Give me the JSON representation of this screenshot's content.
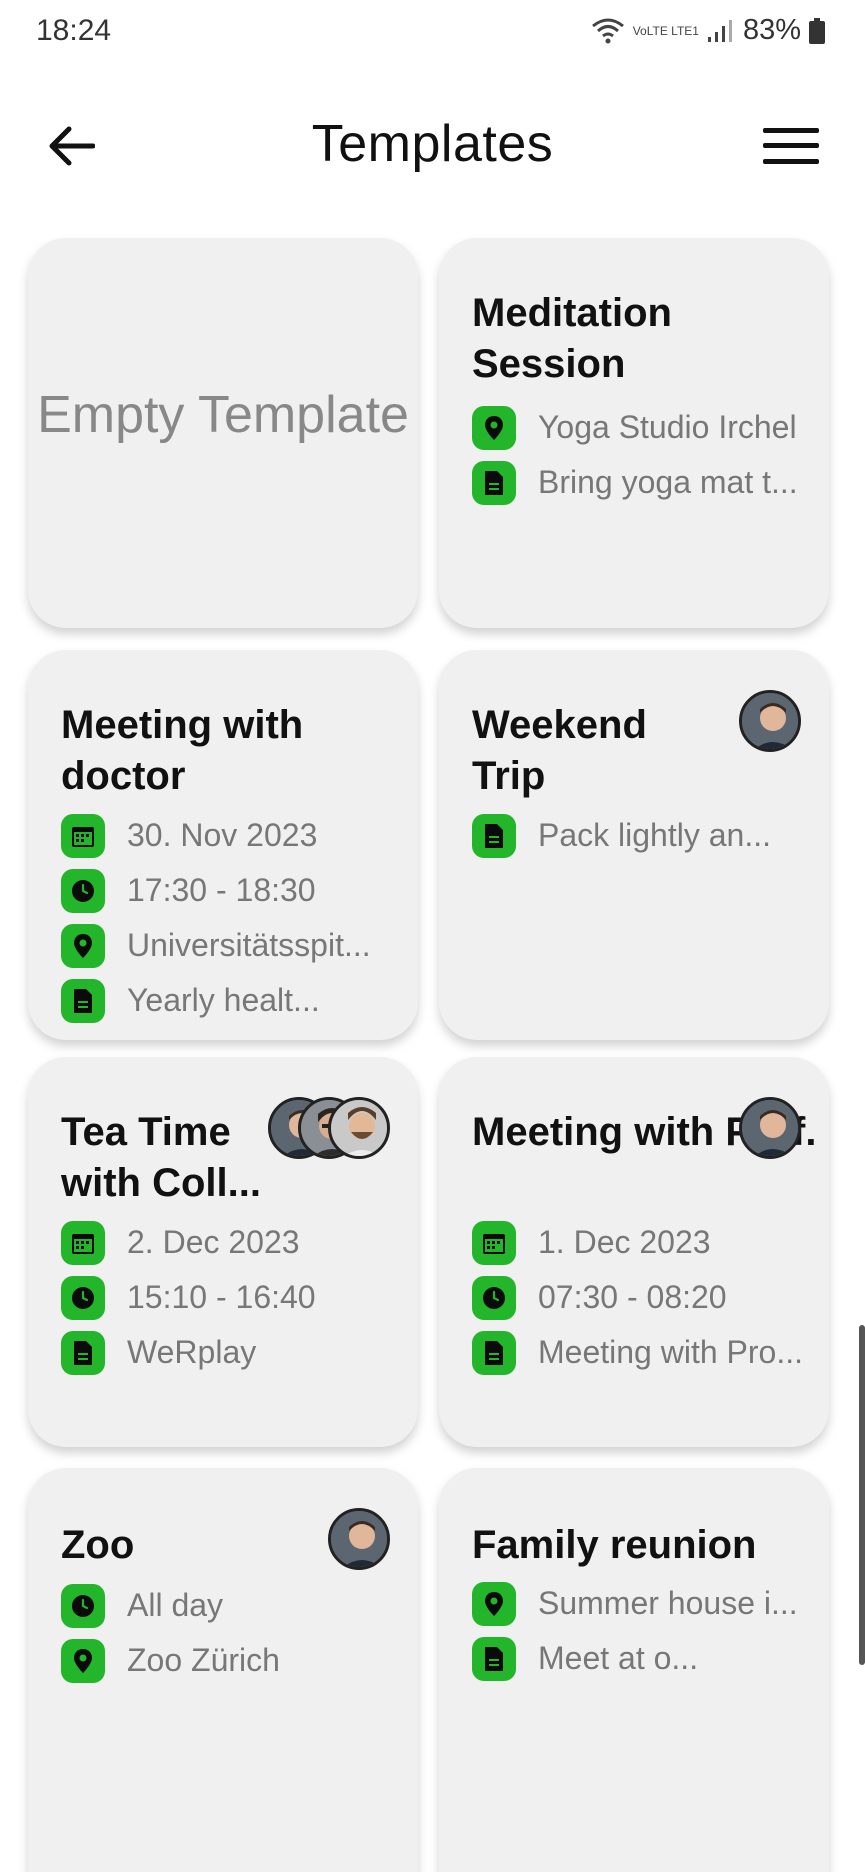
{
  "status": {
    "time": "18:24",
    "battery": "83%",
    "network": "VoLTE LTE1"
  },
  "header": {
    "title": "Templates"
  },
  "icons": {
    "back": "back-arrow-icon",
    "menu": "hamburger-menu-icon",
    "date": "calendar-icon",
    "time": "clock-icon",
    "location": "location-pin-icon",
    "note": "note-icon"
  },
  "colors": {
    "accent": "#23b52a",
    "card": "#f0f0f0"
  },
  "empty_template": {
    "label": "Empty Template"
  },
  "templates": [
    {
      "title": "Meditation Session",
      "location": "Yoga Studio Irchel",
      "note": "Bring yoga mat t..."
    },
    {
      "title": "Meeting with doctor",
      "date": "30. Nov 2023",
      "time": "17:30 - 18:30",
      "location": "Universitätsspit...",
      "note": "Yearly healt..."
    },
    {
      "title": "Weekend Trip",
      "note": "Pack lightly an..."
    },
    {
      "title": "Tea Time with Coll...",
      "date": "2. Dec 2023",
      "time": "15:10 - 16:40",
      "note": "WeRplay"
    },
    {
      "title": "Meeting with Prof. Behjet ..",
      "date": "1. Dec 2023",
      "time": "07:30 - 08:20",
      "note": "Meeting with Pro..."
    },
    {
      "title": "Zoo",
      "time": "All day",
      "location": "Zoo Zürich"
    },
    {
      "title": "Family reunion",
      "location": "Summer house i...",
      "note": "Meet at o..."
    }
  ]
}
